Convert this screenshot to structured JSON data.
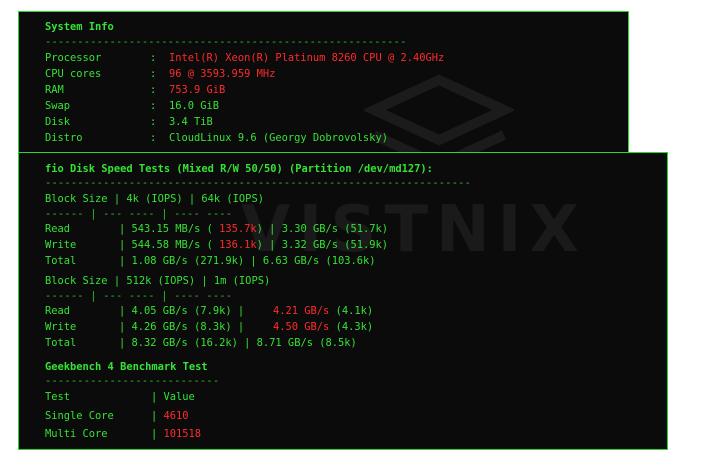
{
  "system_info": {
    "title": "System Info",
    "separator": "--------------------------------------------------------",
    "rows": [
      {
        "label": "Processor",
        "sep": ":",
        "value": "Intel(R) Xeon(R) Platinum 8260 CPU @ 2.40GHz",
        "color": "#ff2a2a"
      },
      {
        "label": "CPU cores",
        "sep": ":",
        "value": "96 @ 3593.959 MHz",
        "color": "#ff2a2a"
      },
      {
        "label": "RAM",
        "sep": ":",
        "value": "753.9 GiB",
        "color": "#ff2a2a"
      },
      {
        "label": "Swap",
        "sep": ":",
        "value": "16.0 GiB",
        "color": "#36e236"
      },
      {
        "label": "Disk",
        "sep": ":",
        "value": "3.4 TiB",
        "color": "#36e236"
      },
      {
        "label": "Distro",
        "sep": ":",
        "value": "CloudLinux 9.6 (Georgy Dobrovolsky)",
        "color": "#36e236"
      }
    ]
  },
  "fio": {
    "title": "fio Disk Speed Tests (Mixed R/W 50/50) (Partition /dev/md127):",
    "separator": "------------------------------------------------------------------",
    "block1": {
      "header": "Block Size | 4k (IOPS) | 64k (IOPS)",
      "dashes": "------ | --- ---- | ---- ----",
      "rows": [
        {
          "label": "Read",
          "a_speed": "543.15 MB/s",
          "a_iops": "135.7k",
          "b": "3.30 GB/s (51.7k)"
        },
        {
          "label": "Write",
          "a_speed": "544.58 MB/s",
          "a_iops": "136.1k",
          "b": "3.32 GB/s (51.9k)"
        },
        {
          "label": "Total",
          "a_speed": "1.08 GB/s (271.9k)",
          "a_iops": "",
          "b": "6.63 GB/s (103.6k)"
        }
      ]
    },
    "block2": {
      "header": "Block Size | 512k (IOPS) | 1m (IOPS)",
      "dashes": "------ | --- ---- | ---- ----",
      "rows": [
        {
          "label": "Read",
          "a": "4.05 GB/s (7.9k)",
          "b_speed": "4.21 GB/s",
          "b_iops": "(4.1k)"
        },
        {
          "label": "Write",
          "a": "4.26 GB/s (8.3k)",
          "b_speed": "4.50 GB/s",
          "b_iops": "(4.3k)"
        },
        {
          "label": "Total",
          "a": "8.32 GB/s (16.2k)",
          "b_speed": "8.71 GB/s (8.5k)",
          "b_iops": ""
        }
      ]
    }
  },
  "geekbench": {
    "title": "Geekbench 4 Benchmark Test",
    "separator": "---------------------------",
    "col_test": "Test",
    "col_value": "Value",
    "rows": [
      {
        "label": "Single Core",
        "value": "4610"
      },
      {
        "label": "Multi Core",
        "value": "101518"
      }
    ]
  },
  "watermark": "VISTNIX"
}
